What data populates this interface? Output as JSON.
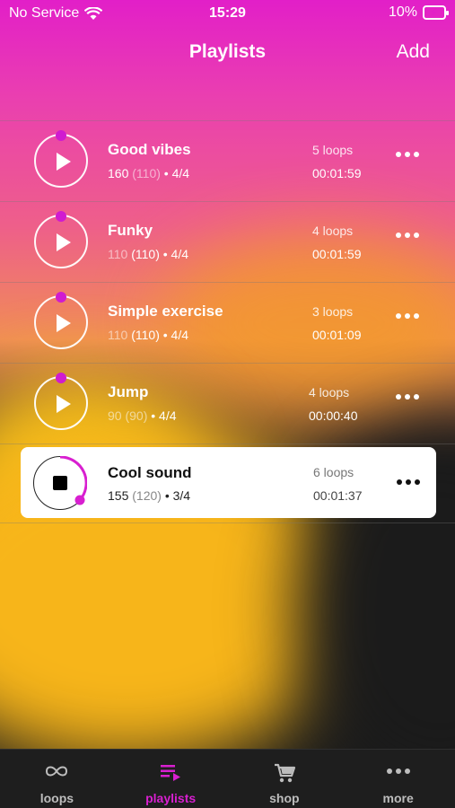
{
  "status_bar": {
    "carrier": "No Service",
    "time": "15:29",
    "battery": "10%"
  },
  "nav": {
    "title": "Playlists",
    "add": "Add"
  },
  "playlists": [
    {
      "name": "Good vibes",
      "bpm": "160",
      "base_bpm": "(110)",
      "meter": " • 4/4",
      "loops": "5 loops",
      "duration": "00:01:59"
    },
    {
      "name": "Funky",
      "bpm": "110",
      "base_bpm": "(110)",
      "meter": " • 4/4",
      "loops": "4 loops",
      "duration": "00:01:59"
    },
    {
      "name": "Simple exercise",
      "bpm": "110",
      "base_bpm": "(110)",
      "meter": " • 4/4",
      "loops": "3 loops",
      "duration": "00:01:09"
    },
    {
      "name": "Jump",
      "bpm": "90",
      "base_bpm": "(90)",
      "meter": " • 4/4",
      "loops": "4 loops",
      "duration": "00:00:40"
    },
    {
      "name": "Cool sound",
      "bpm": "155",
      "base_bpm": "(120)",
      "meter": " • 3/4",
      "loops": "6 loops",
      "duration": "00:01:37",
      "playing": true
    }
  ],
  "tabs": [
    {
      "label": "loops",
      "icon": "infinity-icon",
      "active": false
    },
    {
      "label": "playlists",
      "icon": "playlist-icon",
      "active": true
    },
    {
      "label": "shop",
      "icon": "cart-icon",
      "active": false
    },
    {
      "label": "more",
      "icon": "more-dots-icon",
      "active": false
    }
  ],
  "colors": {
    "accent": "#d81fd0",
    "gradient_top": "#e21fc8",
    "gradient_mid": "#f08e55",
    "yellow": "#f7b51a"
  }
}
